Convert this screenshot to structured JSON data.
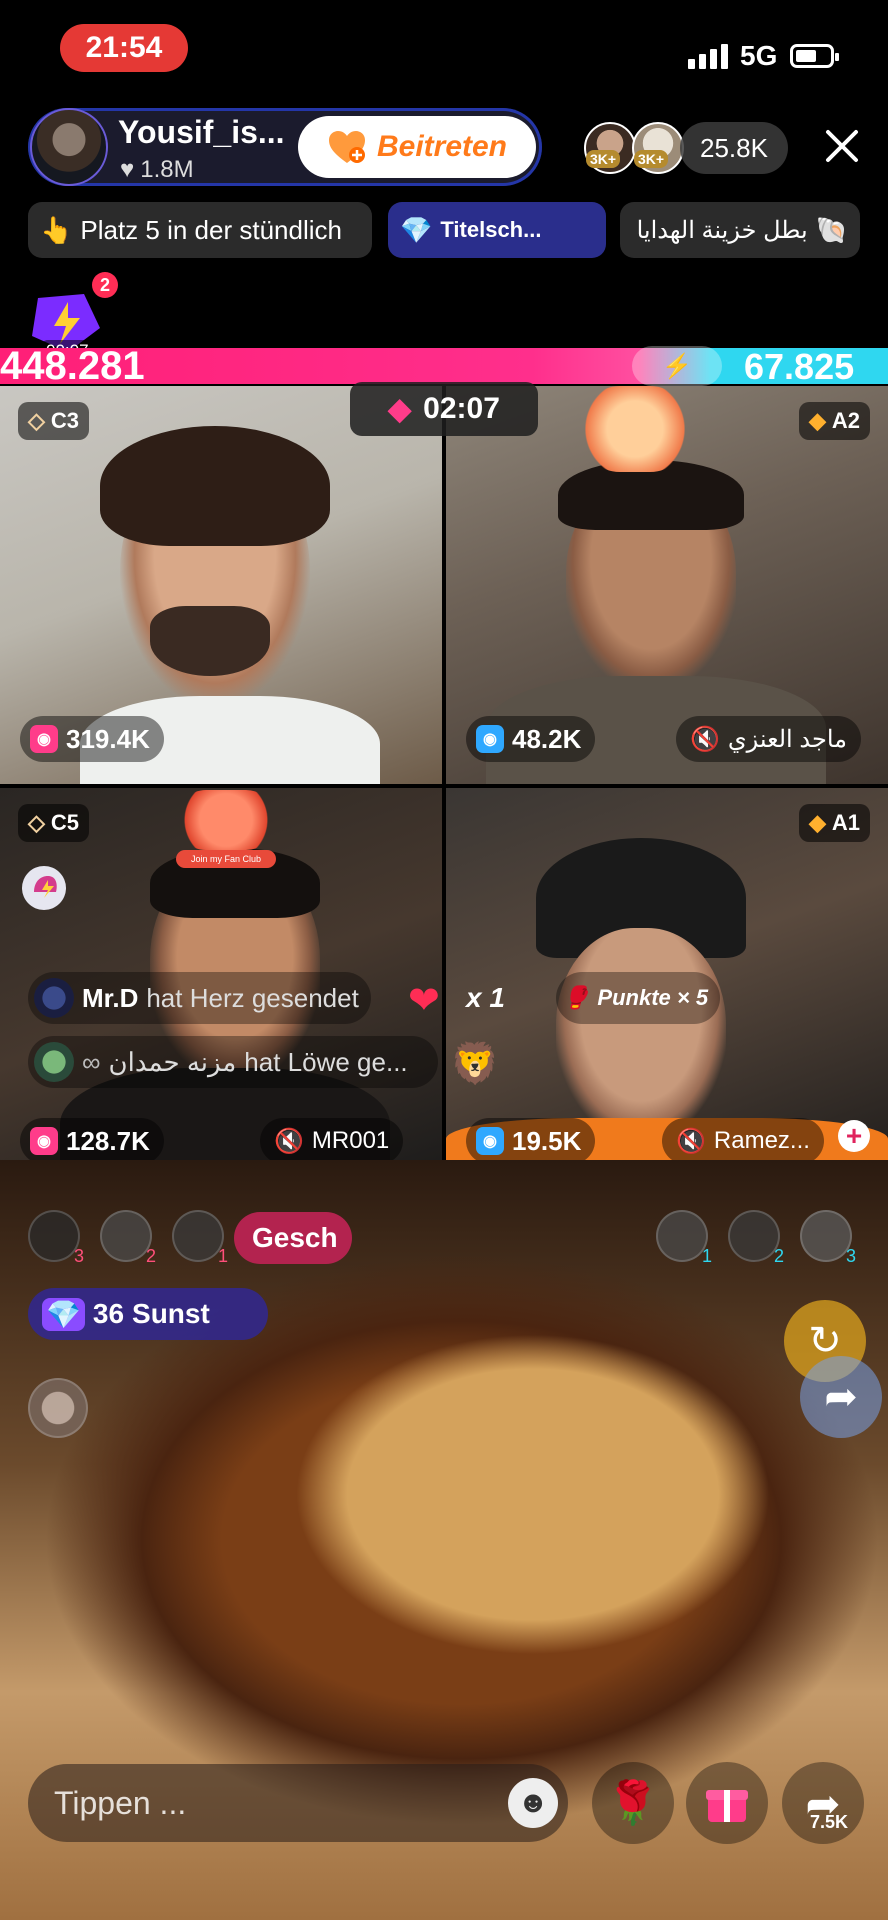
{
  "status": {
    "time": "21:54",
    "network": "5G"
  },
  "host": {
    "name": "Yousif_is...",
    "likes": "1.8M",
    "join_label": "Beitreten"
  },
  "viewers": {
    "badge_1": "3K+",
    "badge_2": "3K+",
    "count": "25.8K"
  },
  "chips": [
    {
      "label": "Platz 5 in der stündlich"
    },
    {
      "label": "Titelsch..."
    },
    {
      "label": "بطل خزينة الهدايا"
    }
  ],
  "flash": {
    "notifications": "2",
    "timer": "00:07"
  },
  "battle": {
    "score_left": "448.281",
    "score_right": "67.825",
    "timer": "02:07"
  },
  "tiles": [
    {
      "rank": "C3",
      "viewers": "319.4K",
      "name": ""
    },
    {
      "rank": "A2",
      "viewers": "48.2K",
      "name": "ماجد العنزي"
    },
    {
      "rank": "C5",
      "viewers": "128.7K",
      "name": "MR001"
    },
    {
      "rank": "A1",
      "viewers": "19.5K",
      "name": "Ramez..."
    }
  ],
  "comments": [
    {
      "user": "Mr.D",
      "text": "hat Herz  gesendet",
      "count": "x 1"
    },
    {
      "user": "مزنه حمدان",
      "text": "hat Löwe  ge..."
    }
  ],
  "points": {
    "label": "Punkte × 5"
  },
  "fanclub": {
    "label": "Join my Fan Club"
  },
  "guests_left": [
    "3",
    "2",
    "1"
  ],
  "guests_right": [
    "1",
    "2",
    "3"
  ],
  "gift_tab": {
    "label": "Gesch"
  },
  "sunst": {
    "count": "36",
    "label": "Sunst"
  },
  "input": {
    "placeholder": "Tippen ..."
  },
  "share_count": "7.5K",
  "colors": {
    "accent_pink": "#ff1f77",
    "accent_cyan": "#2fd7f0",
    "join_orange": "#ff7a1a",
    "live_red": "#e53935"
  }
}
